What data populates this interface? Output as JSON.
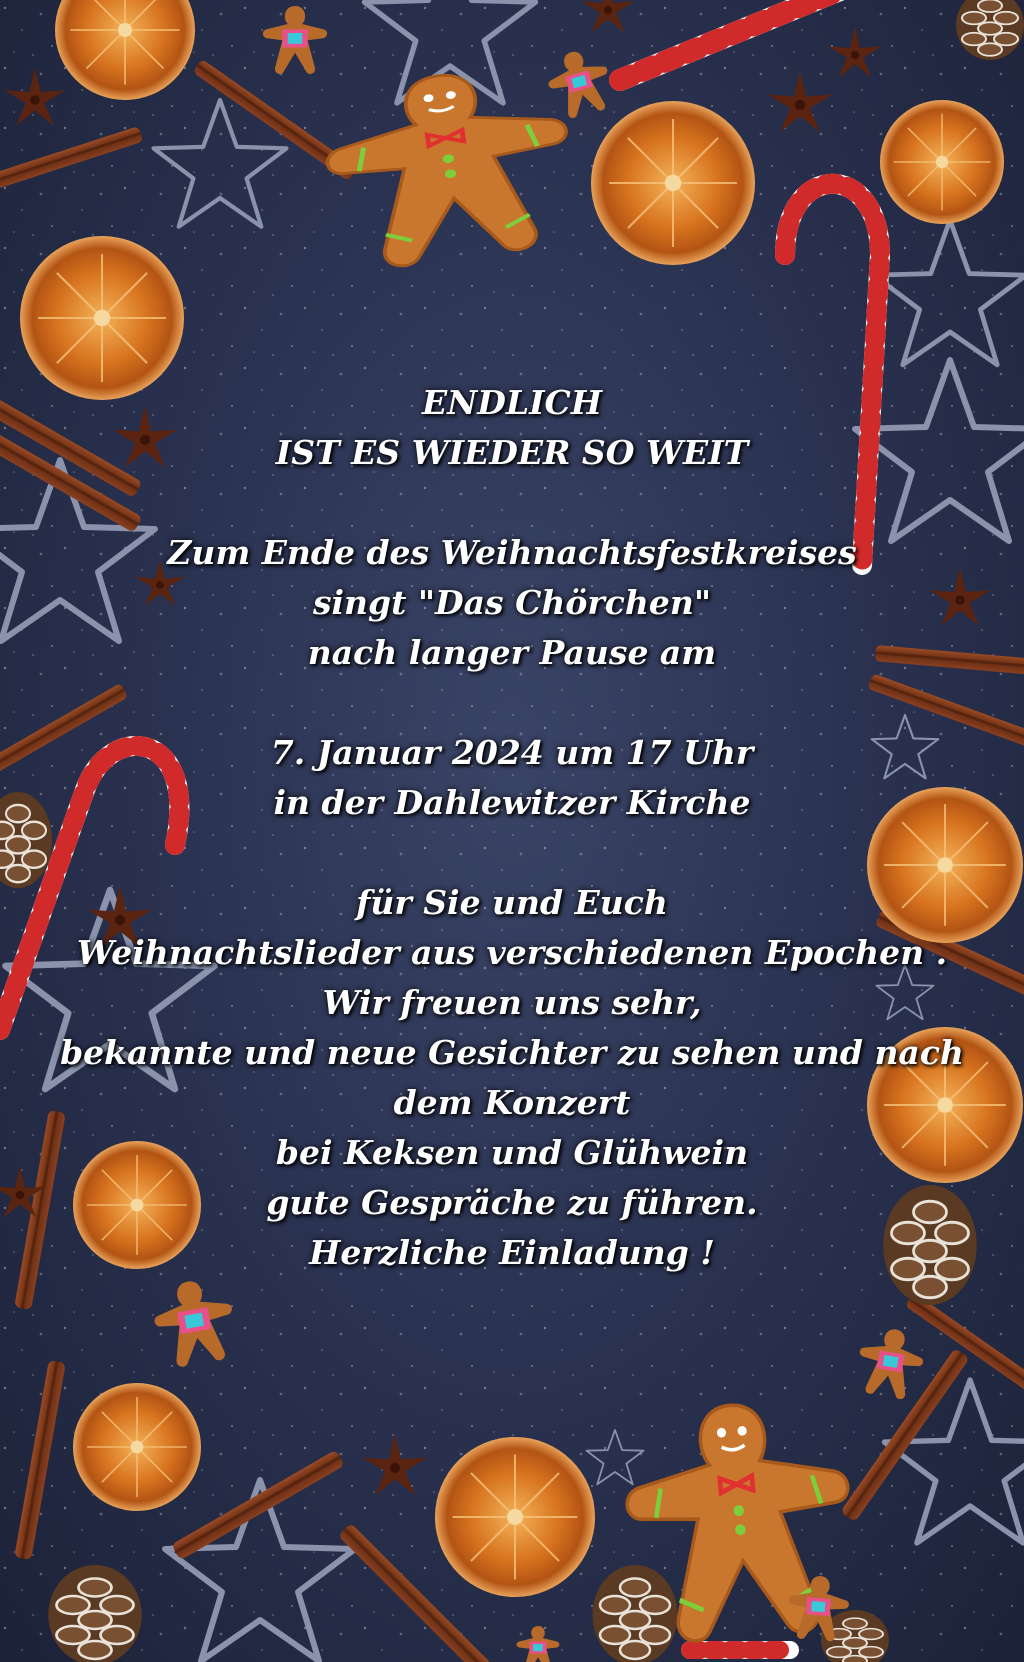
{
  "palette": {
    "background": "#2b3352",
    "orange_rind": "#d9782a",
    "orange_flesh": "#e08a2e",
    "cinnamon": "#7a3a1e",
    "gingerbread": "#c9772f",
    "candy_red": "#d12a2a",
    "text": "#ffffff"
  },
  "icons": [
    "dried-orange-slice-icon",
    "cinnamon-stick-icon",
    "gingerbread-man-icon",
    "candy-cane-icon",
    "star-anise-icon",
    "star-cookie-cutter-icon",
    "pine-cone-icon",
    "small-gingerbread-cookie-icon"
  ],
  "invitation": {
    "headline_1": "ENDLICH",
    "headline_2": "IST ES WIEDER SO WEIT",
    "intro_1": "Zum Ende des Weihnachtsfestkreises",
    "intro_2": "singt \"Das Chörchen\"",
    "intro_3": "nach langer Pause am",
    "date_line": "7. Januar 2024 um 17 Uhr",
    "place_line": "in der Dahlewitzer Kirche",
    "body_1": "für Sie und Euch",
    "body_2": "Weihnachtslieder aus verschiedenen Epochen .",
    "body_3": "Wir freuen uns sehr,",
    "body_4": "bekannte und neue Gesichter zu sehen und nach",
    "body_5": "dem Konzert",
    "body_6": "bei Keksen und Glühwein",
    "body_7": "gute Gespräche zu führen.",
    "closing": "Herzliche Einladung !"
  }
}
